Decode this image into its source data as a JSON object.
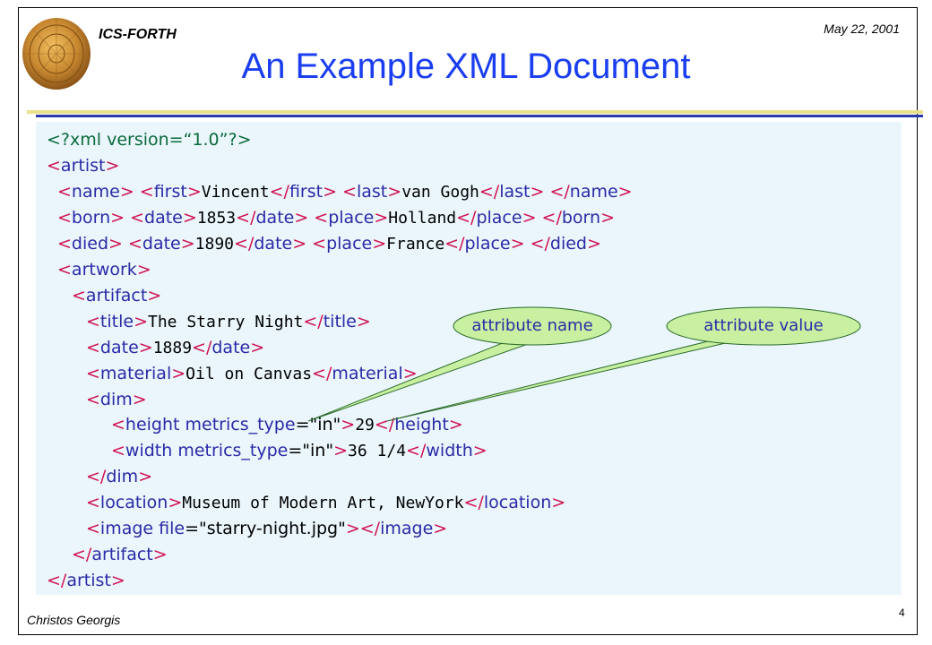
{
  "header": {
    "org": "ICS-FORTH",
    "date": "May 22, 2001",
    "title": "An Example XML Document"
  },
  "code_lines": [
    [
      [
        "pi",
        "<?xml version=“1.0”?>"
      ]
    ],
    [
      [
        "m",
        "<"
      ],
      [
        "t",
        "artist"
      ],
      [
        "m",
        ">"
      ]
    ],
    [
      [
        "m",
        "<"
      ],
      [
        "t",
        "name"
      ],
      [
        "m",
        "> <"
      ],
      [
        "t",
        "first"
      ],
      [
        "m",
        ">"
      ],
      [
        "c",
        "Vincent"
      ],
      [
        "m",
        "</"
      ],
      [
        "t",
        "first"
      ],
      [
        "m",
        "> <"
      ],
      [
        "t",
        "last"
      ],
      [
        "m",
        ">"
      ],
      [
        "c",
        "van Gogh"
      ],
      [
        "m",
        "</"
      ],
      [
        "t",
        "last"
      ],
      [
        "m",
        "> </"
      ],
      [
        "t",
        "name"
      ],
      [
        "m",
        ">"
      ]
    ],
    [
      [
        "m",
        "<"
      ],
      [
        "t",
        "born"
      ],
      [
        "m",
        "> <"
      ],
      [
        "t",
        "date"
      ],
      [
        "m",
        ">"
      ],
      [
        "c",
        "1853"
      ],
      [
        "m",
        "</"
      ],
      [
        "t",
        "date"
      ],
      [
        "m",
        "> <"
      ],
      [
        "t",
        "place"
      ],
      [
        "m",
        ">"
      ],
      [
        "c",
        "Holland"
      ],
      [
        "m",
        "</"
      ],
      [
        "t",
        "place"
      ],
      [
        "m",
        "> </"
      ],
      [
        "t",
        "born"
      ],
      [
        "m",
        ">"
      ]
    ],
    [
      [
        "m",
        "<"
      ],
      [
        "t",
        "died"
      ],
      [
        "m",
        "> <"
      ],
      [
        "t",
        "date"
      ],
      [
        "m",
        ">"
      ],
      [
        "c",
        "1890"
      ],
      [
        "m",
        "</"
      ],
      [
        "t",
        "date"
      ],
      [
        "m",
        "> <"
      ],
      [
        "t",
        "place"
      ],
      [
        "m",
        ">"
      ],
      [
        "c",
        "France"
      ],
      [
        "m",
        "</"
      ],
      [
        "t",
        "place"
      ],
      [
        "m",
        "> </"
      ],
      [
        "t",
        "died"
      ],
      [
        "m",
        ">"
      ]
    ],
    [
      [
        "m",
        "<"
      ],
      [
        "t",
        "artwork"
      ],
      [
        "m",
        ">"
      ]
    ],
    [
      [
        "m",
        "<"
      ],
      [
        "t",
        "artifact"
      ],
      [
        "m",
        ">"
      ]
    ],
    [
      [
        "m",
        "<"
      ],
      [
        "t",
        "title"
      ],
      [
        "m",
        ">"
      ],
      [
        "c",
        "The Starry Night"
      ],
      [
        "m",
        "</"
      ],
      [
        "t",
        "title"
      ],
      [
        "m",
        ">"
      ]
    ],
    [
      [
        "m",
        "<"
      ],
      [
        "t",
        "date"
      ],
      [
        "m",
        ">"
      ],
      [
        "c",
        "1889"
      ],
      [
        "m",
        "</"
      ],
      [
        "t",
        "date"
      ],
      [
        "m",
        ">"
      ]
    ],
    [
      [
        "m",
        "<"
      ],
      [
        "t",
        "material"
      ],
      [
        "m",
        ">"
      ],
      [
        "c",
        "Oil on Canvas"
      ],
      [
        "m",
        "</"
      ],
      [
        "t",
        "material"
      ],
      [
        "m",
        ">"
      ]
    ],
    [
      [
        "m",
        "<"
      ],
      [
        "t",
        "dim"
      ],
      [
        "m",
        ">"
      ]
    ],
    [
      [
        "m",
        "<"
      ],
      [
        "t",
        "height metrics_type"
      ],
      [
        "q",
        "=\"in\""
      ],
      [
        "m",
        ">"
      ],
      [
        "c",
        "29"
      ],
      [
        "m",
        "</"
      ],
      [
        "t",
        "height"
      ],
      [
        "m",
        ">"
      ]
    ],
    [
      [
        "m",
        "<"
      ],
      [
        "t",
        "width metrics_type"
      ],
      [
        "q",
        "=\"in\""
      ],
      [
        "m",
        ">"
      ],
      [
        "c",
        "36 1/4"
      ],
      [
        "m",
        "</"
      ],
      [
        "t",
        "width"
      ],
      [
        "m",
        ">"
      ]
    ],
    [
      [
        "m",
        "</"
      ],
      [
        "t",
        "dim"
      ],
      [
        "m",
        ">"
      ]
    ],
    [
      [
        "m",
        "<"
      ],
      [
        "t",
        "location"
      ],
      [
        "m",
        ">"
      ],
      [
        "c",
        "Museum of Modern Art, NewYork"
      ],
      [
        "m",
        "</"
      ],
      [
        "t",
        "location"
      ],
      [
        "m",
        ">"
      ]
    ],
    [
      [
        "m",
        "<"
      ],
      [
        "t",
        "image file"
      ],
      [
        "q",
        "=\"starry-night.jpg\""
      ],
      [
        "m",
        "></"
      ],
      [
        "t",
        "image"
      ],
      [
        "m",
        ">"
      ]
    ],
    [
      [
        "m",
        "</"
      ],
      [
        "t",
        "artifact"
      ],
      [
        "m",
        ">"
      ]
    ],
    [
      [
        "m",
        "</"
      ],
      [
        "t",
        "artist"
      ],
      [
        "m",
        ">"
      ]
    ]
  ],
  "callouts": {
    "attr_name": "attribute name",
    "attr_value": "attribute value"
  },
  "footer": {
    "author": "Christos Georgis",
    "page": "4"
  },
  "colors": {
    "title": "#1a3ef0",
    "markup": "#d01050",
    "tag": "#2a2aa8",
    "callout_fill": "#c8f0a0"
  }
}
